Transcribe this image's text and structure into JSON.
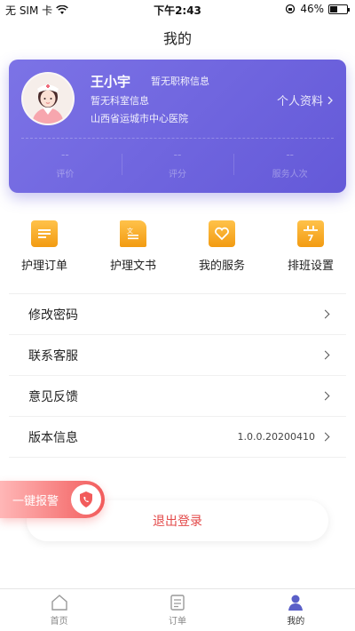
{
  "status_bar": {
    "carrier": "无 SIM 卡",
    "time": "下午2:43",
    "battery": "46%",
    "battery_level": 0.46
  },
  "page": {
    "title": "我的"
  },
  "profile": {
    "name": "王小宇",
    "title_info": "暂无职称信息",
    "dept_info": "暂无科室信息",
    "hospital": "山西省运城市中心医院",
    "profile_link": "个人资料",
    "stats": [
      {
        "value": "--",
        "label": "评价"
      },
      {
        "value": "--",
        "label": "评分"
      },
      {
        "value": "--",
        "label": "服务人次"
      }
    ]
  },
  "quick_menu": [
    {
      "label": "护理订单",
      "icon": "order-list-icon"
    },
    {
      "label": "护理文书",
      "icon": "document-icon"
    },
    {
      "label": "我的服务",
      "icon": "heart-service-icon"
    },
    {
      "label": "排班设置",
      "icon": "calendar-icon",
      "badge": "7"
    }
  ],
  "settings": [
    {
      "label": "修改密码",
      "value": ""
    },
    {
      "label": "联系客服",
      "value": ""
    },
    {
      "label": "意见反馈",
      "value": ""
    },
    {
      "label": "版本信息",
      "value": "1.0.0.20200410"
    }
  ],
  "alarm": {
    "label": "一键报警"
  },
  "logout": {
    "label": "退出登录"
  },
  "tabs": [
    {
      "label": "首页",
      "active": false
    },
    {
      "label": "订单",
      "active": false
    },
    {
      "label": "我的",
      "active": true
    }
  ],
  "colors": {
    "card_gradient_start": "#7c73e6",
    "card_gradient_end": "#6459d8",
    "icon_gradient": "#f29b12",
    "logout_text": "#e34a4a",
    "alarm_red": "#f25b5b"
  }
}
